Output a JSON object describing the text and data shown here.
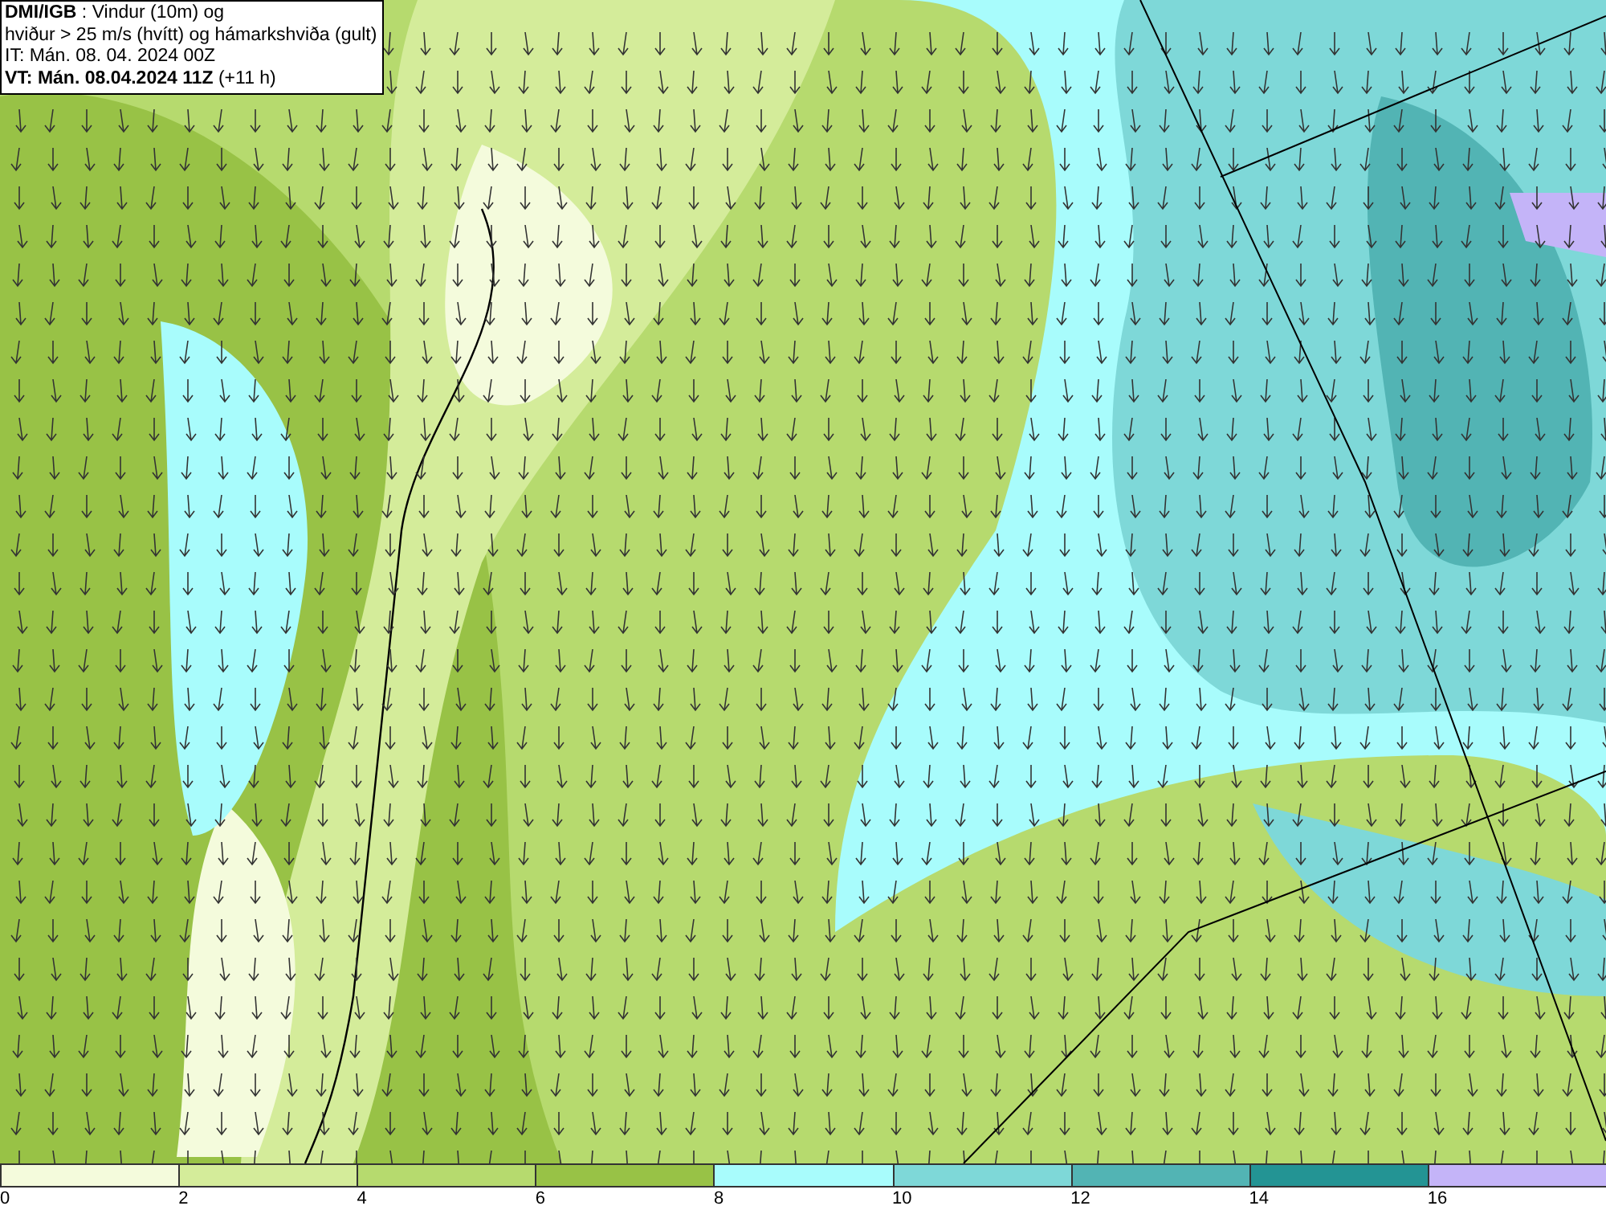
{
  "header": {
    "lines": [
      "**DMI/IGB** : Vindur (10m) og",
      "hviður > 25 m/s (hvítt) og hámarkshviða (gult)",
      "IT: Mán. 08. 04. 2024 00Z",
      "**VT: Mán. 08.04.2024 11Z** (+11 h)"
    ]
  },
  "legend": [
    {
      "label": "0",
      "color": "#f4fbdc"
    },
    {
      "label": "2",
      "color": "#d4ec9a"
    },
    {
      "label": "4",
      "color": "#b6da6e"
    },
    {
      "label": "6",
      "color": "#98c246"
    },
    {
      "label": "8",
      "color": "#a8fcfc"
    },
    {
      "label": "10",
      "color": "#7ed8d8"
    },
    {
      "label": "12",
      "color": "#52b4b4"
    },
    {
      "label": "14",
      "color": "#239494"
    },
    {
      "label": "16",
      "color": "#c4b4f8"
    }
  ]
}
